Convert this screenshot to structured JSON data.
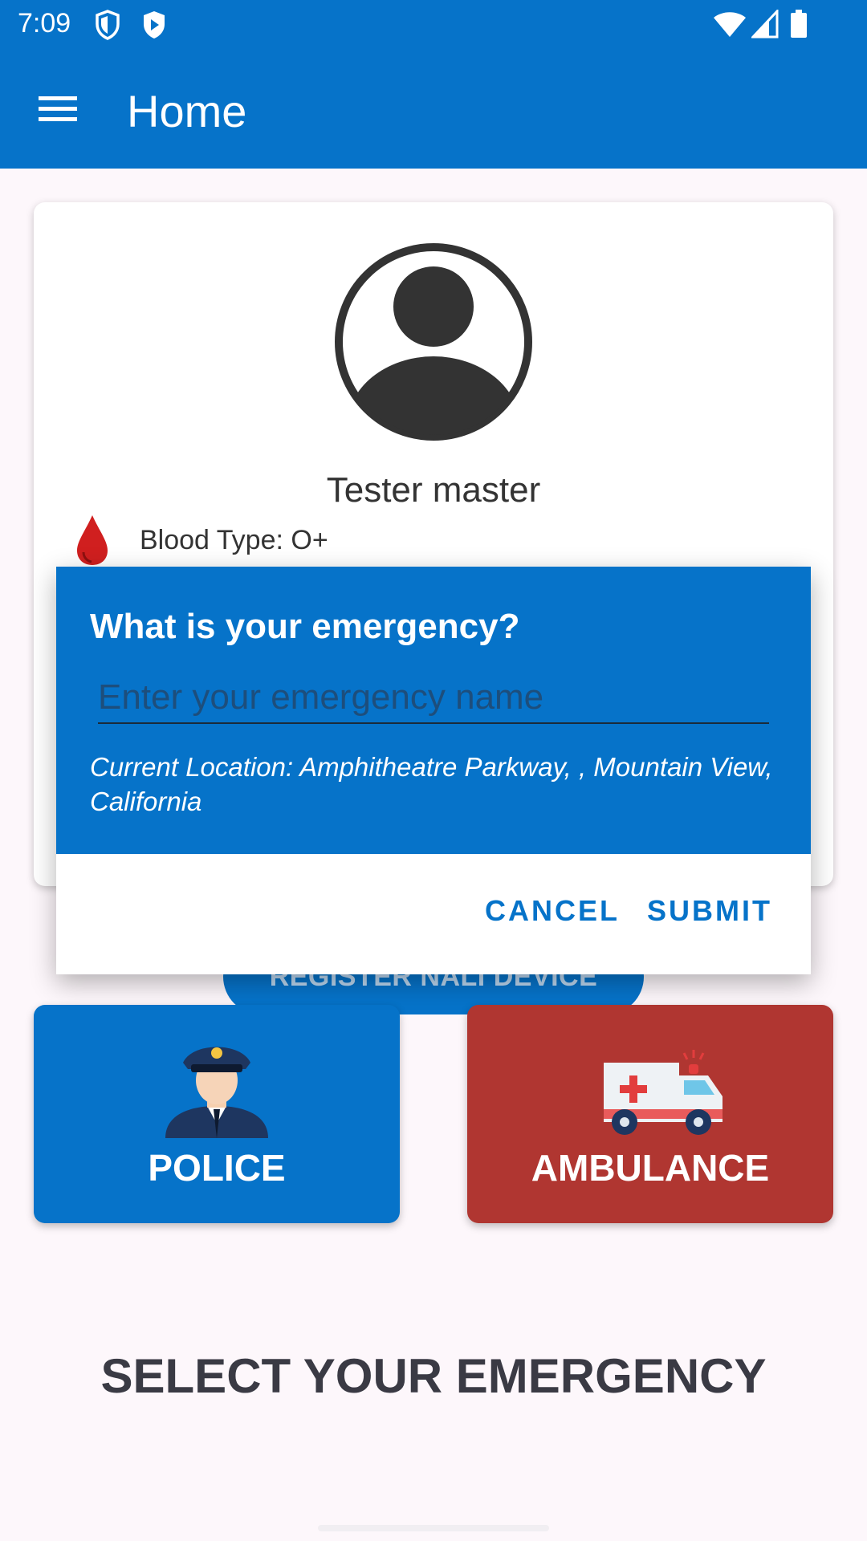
{
  "status_bar": {
    "time": "7:09",
    "left_icons": [
      "shield-icon",
      "play-shield-icon"
    ],
    "right_icons": [
      "wifi-icon",
      "cell-signal-icon",
      "battery-icon"
    ]
  },
  "app_bar": {
    "title": "Home",
    "menu_icon": "hamburger-menu-icon"
  },
  "profile": {
    "name": "Tester master",
    "blood_type_label": "Blood Type: O+"
  },
  "register_button": {
    "label": "REGISTER NALI DEVICE"
  },
  "tiles": [
    {
      "label": "POLICE",
      "icon": "police-officer-icon",
      "color": "#0673c9"
    },
    {
      "label": "AMBULANCE",
      "icon": "ambulance-icon",
      "color": "#b03631"
    }
  ],
  "select_heading": "SELECT YOUR EMERGENCY",
  "dialog": {
    "title": "What is your emergency?",
    "input_placeholder": "Enter your emergency name",
    "input_value": "",
    "location": "Current Location: Amphitheatre Parkway, , Mountain View, California",
    "cancel_label": "CANCEL",
    "submit_label": "SUBMIT"
  },
  "colors": {
    "primary": "#0673c9",
    "ambulance": "#b03631",
    "blood": "#d01f1f"
  }
}
